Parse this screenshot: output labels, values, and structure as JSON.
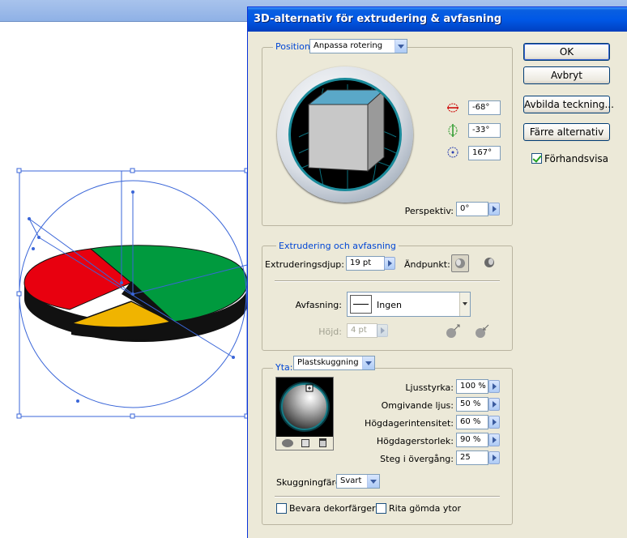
{
  "dialog": {
    "title": "3D-alternativ för extrudering & avfasning",
    "buttons": {
      "ok": "OK",
      "cancel": "Avbryt",
      "map_art": "Avbilda teckning...",
      "fewer_options": "Färre alternativ"
    },
    "preview": {
      "label": "Förhandsvisa",
      "checked": true
    }
  },
  "position": {
    "label": "Position:",
    "value": "Anpassa rotering",
    "rotate_x": "-68°",
    "rotate_y": "-33°",
    "rotate_z": "167°",
    "perspective_label": "Perspektiv:",
    "perspective_value": "0°"
  },
  "extrude": {
    "section_label": "Extrudering och avfasning",
    "depth_label": "Extruderingsdjup:",
    "depth_value": "19 pt",
    "cap_label": "Ändpunkt:",
    "bevel_label": "Avfasning:",
    "bevel_value": "Ingen",
    "height_label": "Höjd:",
    "height_value": "4 pt"
  },
  "surface": {
    "label": "Yta:",
    "value": "Plastskuggning",
    "light_intensity_label": "Ljusstyrka:",
    "light_intensity_value": "100 %",
    "ambient_label": "Omgivande ljus:",
    "ambient_value": "50 %",
    "highlight_intensity_label": "Högdagerintensitet:",
    "highlight_intensity_value": "60 %",
    "highlight_size_label": "Högdagerstorlek:",
    "highlight_size_value": "90 %",
    "blend_steps_label": "Steg i övergång:",
    "blend_steps_value": "25",
    "shading_color_label": "Skuggningfärg:",
    "shading_color_value": "Svart",
    "preserve_spot_label": "Bevara dekorfärger",
    "preserve_spot_checked": false,
    "draw_hidden_label": "Rita gömda ytor",
    "draw_hidden_checked": false
  },
  "colors": {
    "title_bar": "#0058e6",
    "dialog_bg": "#ece9d8",
    "legend_text": "#0046d5",
    "pie_red": "#e8000f",
    "pie_green": "#009a3e",
    "pie_yellow": "#f0b400",
    "selection": "#3a66d8"
  }
}
